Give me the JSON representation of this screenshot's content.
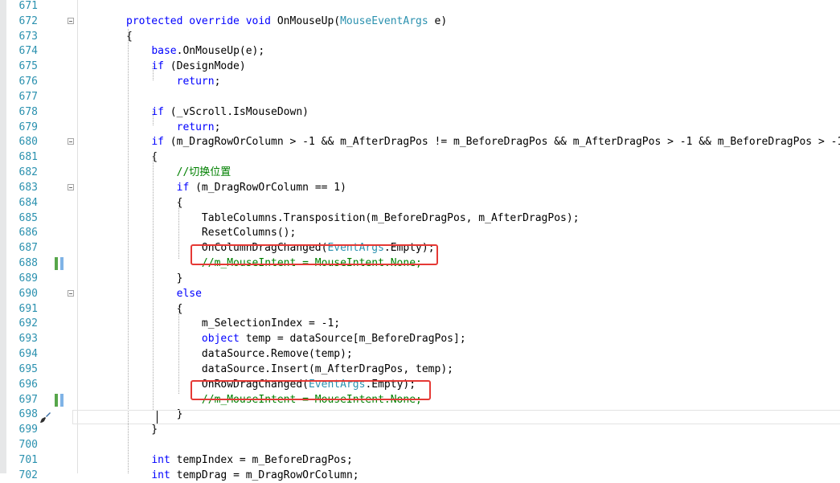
{
  "editor": {
    "lines": [
      {
        "no": "671",
        "segs": []
      },
      {
        "no": "672",
        "segs": [
          [
            "kw",
            "protected override void"
          ],
          [
            "",
            " OnMouseUp("
          ],
          [
            "ty",
            "MouseEventArgs"
          ],
          [
            "",
            " e)"
          ]
        ]
      },
      {
        "no": "673",
        "segs": [
          [
            "",
            "{"
          ]
        ]
      },
      {
        "no": "674",
        "segs": [
          [
            "",
            "    "
          ],
          [
            "kw",
            "base"
          ],
          [
            "",
            ".OnMouseUp(e);"
          ]
        ]
      },
      {
        "no": "675",
        "segs": [
          [
            "",
            "    "
          ],
          [
            "kw",
            "if"
          ],
          [
            "",
            " (DesignMode)"
          ]
        ]
      },
      {
        "no": "676",
        "segs": [
          [
            "",
            "        "
          ],
          [
            "kw",
            "return"
          ],
          [
            "",
            ";"
          ]
        ]
      },
      {
        "no": "677",
        "segs": []
      },
      {
        "no": "678",
        "segs": [
          [
            "",
            "    "
          ],
          [
            "kw",
            "if"
          ],
          [
            "",
            " (_vScroll.IsMouseDown)"
          ]
        ]
      },
      {
        "no": "679",
        "segs": [
          [
            "",
            "        "
          ],
          [
            "kw",
            "return"
          ],
          [
            "",
            ";"
          ]
        ]
      },
      {
        "no": "680",
        "segs": [
          [
            "",
            "    "
          ],
          [
            "kw",
            "if"
          ],
          [
            "",
            " (m_DragRowOrColumn > -1 && m_AfterDragPos != m_BeforeDragPos && m_AfterDragPos > -1 && m_BeforeDragPos > -1"
          ]
        ]
      },
      {
        "no": "681",
        "segs": [
          [
            "",
            "    {"
          ]
        ]
      },
      {
        "no": "682",
        "segs": [
          [
            "",
            "        "
          ],
          [
            "cm",
            "//切换位置"
          ]
        ]
      },
      {
        "no": "683",
        "segs": [
          [
            "",
            "        "
          ],
          [
            "kw",
            "if"
          ],
          [
            "",
            " (m_DragRowOrColumn == 1)"
          ]
        ]
      },
      {
        "no": "684",
        "segs": [
          [
            "",
            "        {"
          ]
        ]
      },
      {
        "no": "685",
        "segs": [
          [
            "",
            "            TableColumns.Transposition(m_BeforeDragPos, m_AfterDragPos);"
          ]
        ]
      },
      {
        "no": "686",
        "segs": [
          [
            "",
            "            ResetColumns();"
          ]
        ]
      },
      {
        "no": "687",
        "segs": [
          [
            "",
            "            OnColumnDragChanged("
          ],
          [
            "ty",
            "EventArgs"
          ],
          [
            "",
            ".Empty);"
          ]
        ]
      },
      {
        "no": "688",
        "segs": [
          [
            "",
            "            "
          ],
          [
            "cm",
            "//m_MouseIntent = MouseIntent.None;"
          ]
        ]
      },
      {
        "no": "689",
        "segs": [
          [
            "",
            "        }"
          ]
        ]
      },
      {
        "no": "690",
        "segs": [
          [
            "",
            "        "
          ],
          [
            "kw",
            "else"
          ]
        ]
      },
      {
        "no": "691",
        "segs": [
          [
            "",
            "        {"
          ]
        ]
      },
      {
        "no": "692",
        "segs": [
          [
            "",
            "            m_SelectionIndex = -1;"
          ]
        ]
      },
      {
        "no": "693",
        "segs": [
          [
            "",
            "            "
          ],
          [
            "kw",
            "object"
          ],
          [
            "",
            " temp = dataSource[m_BeforeDragPos];"
          ]
        ]
      },
      {
        "no": "694",
        "segs": [
          [
            "",
            "            dataSource.Remove(temp);"
          ]
        ]
      },
      {
        "no": "695",
        "segs": [
          [
            "",
            "            dataSource.Insert(m_AfterDragPos, temp);"
          ]
        ]
      },
      {
        "no": "696",
        "segs": [
          [
            "",
            "            OnRowDragChanged("
          ],
          [
            "ty",
            "EventArgs"
          ],
          [
            "",
            ".Empty);"
          ]
        ]
      },
      {
        "no": "697",
        "segs": [
          [
            "",
            "            "
          ],
          [
            "cm",
            "//m_MouseIntent = MouseIntent.None;"
          ]
        ]
      },
      {
        "no": "698",
        "segs": [
          [
            "",
            "        }"
          ]
        ]
      },
      {
        "no": "699",
        "segs": [
          [
            "",
            "    }"
          ]
        ]
      },
      {
        "no": "700",
        "segs": []
      },
      {
        "no": "701",
        "segs": [
          [
            "",
            "    "
          ],
          [
            "kw",
            "int"
          ],
          [
            "",
            " tempIndex = m_BeforeDragPos;"
          ]
        ]
      },
      {
        "no": "702",
        "segs": [
          [
            "",
            "    "
          ],
          [
            "kw",
            "int"
          ],
          [
            "",
            " tempDrag = m_DragRowOrColumn;"
          ]
        ]
      }
    ],
    "fold_lines": [
      "672",
      "680",
      "683",
      "690"
    ],
    "changed_lines": [
      "688",
      "697"
    ],
    "highlighted_lines": [
      "688",
      "697"
    ],
    "current_line": "699",
    "gutter_icon": "quick-action-brush-icon",
    "colors": {
      "keyword": "#0000ff",
      "type": "#2b91af",
      "comment": "#008000",
      "line_number": "#2b91af",
      "highlight_box": "#e53935",
      "change_saved": "#57a64a",
      "change_marker": "#7fb3e6"
    }
  }
}
